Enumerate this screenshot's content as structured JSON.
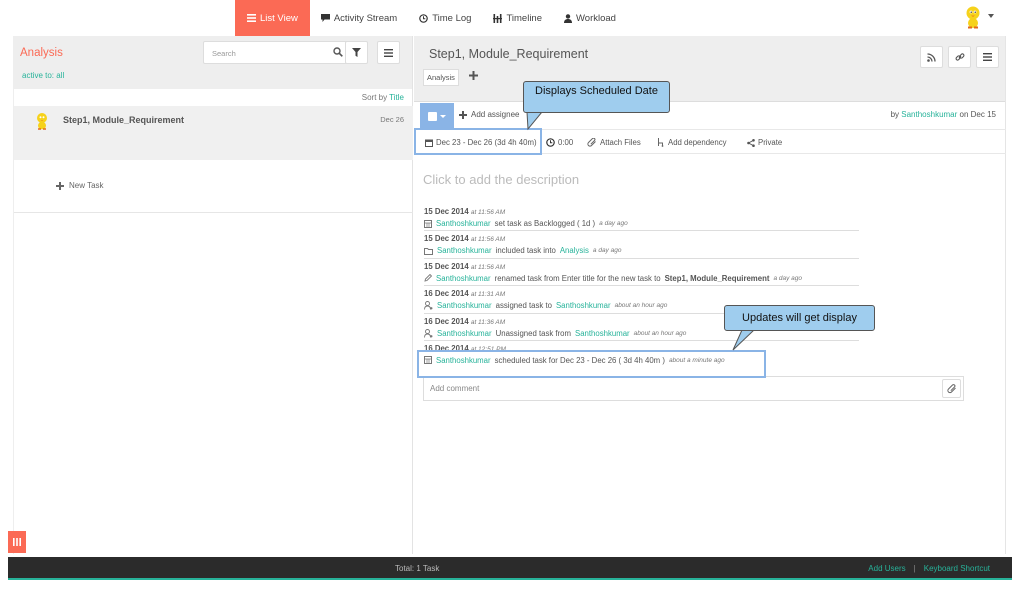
{
  "nav": {
    "items": [
      {
        "label": "List View",
        "icon": "list-icon"
      },
      {
        "label": "Activity Stream",
        "icon": "comment-icon"
      },
      {
        "label": "Time Log",
        "icon": "clock-icon"
      },
      {
        "label": "Timeline",
        "icon": "timeline-icon"
      },
      {
        "label": "Workload",
        "icon": "user-icon"
      }
    ]
  },
  "left": {
    "title": "Analysis",
    "filters": "active  to: all",
    "search_placeholder": "Search",
    "sort_prefix": "Sort by ",
    "sort_field": "Title",
    "task_name": "Step1, Module_Requirement",
    "task_date": "Dec 26",
    "new_task": "New Task"
  },
  "right": {
    "title": "Step1, Module_Requirement",
    "tag": "Analysis",
    "add_assignee": "Add assignee",
    "by_prefix": "by ",
    "by_user": "Santhoshkumar",
    "by_suffix": " on Dec 15",
    "schedule": "Dec 23 - Dec 26 (3d 4h 40m)",
    "time": "0:00",
    "attach": "Attach Files",
    "dependency": "Add dependency",
    "private": "Private",
    "description": "Click to add the description",
    "comment_placeholder": "Add comment"
  },
  "activity": [
    {
      "date": "15 Dec 2014",
      "time": "at 11:56 AM",
      "user": "Santhoshkumar",
      "text": "set task as Backlogged ( 1d )",
      "ago": "a day ago"
    },
    {
      "date": "15 Dec 2014",
      "time": "at 11:56 AM",
      "user": "Santhoshkumar",
      "text": "included task into",
      "link": "Analysis",
      "ago": "a day ago"
    },
    {
      "date": "15 Dec 2014",
      "time": "at 11:56 AM",
      "user": "Santhoshkumar",
      "text": "renamed task from Enter title for the new task to",
      "bold": "Step1, Module_Requirement",
      "ago": "a day ago"
    },
    {
      "date": "16 Dec 2014",
      "time": "at 11:31 AM",
      "user": "Santhoshkumar",
      "text": "assigned task to",
      "link": "Santhoshkumar",
      "ago": "about an hour ago"
    },
    {
      "date": "16 Dec 2014",
      "time": "at 11:36 AM",
      "user": "Santhoshkumar",
      "text": "Unassigned task from",
      "link": "Santhoshkumar",
      "ago": "about an hour ago"
    },
    {
      "date": "16 Dec 2014",
      "time": "at 12:51 PM",
      "user": "Santhoshkumar",
      "text": "scheduled task for Dec 23 - Dec 26 ( 3d 4h 40m )",
      "ago": "about a minute ago"
    }
  ],
  "callouts": {
    "scheduled": "Displays Scheduled Date",
    "updates": "Updates will get display"
  },
  "footer": {
    "total": "Total: 1 Task",
    "add_users": "Add Users",
    "separator": "|",
    "shortcut": "Keyboard Shortcut"
  },
  "colors": {
    "accent": "#fb6a55",
    "link": "#27b39a",
    "highlight": "#8ab4e6",
    "callout": "#9fcdee"
  }
}
